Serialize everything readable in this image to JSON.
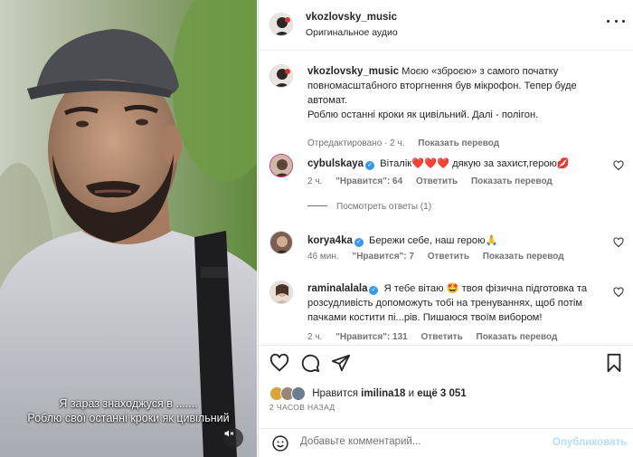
{
  "video": {
    "subtitle_line1": "Я зараз знаходжуся в .......",
    "subtitle_line2": "Роблю свої останні кроки як цивільний",
    "mute_icon": "speaker-muted-icon"
  },
  "header": {
    "username": "vkozlovsky_music",
    "audio_label": "Оригинальное аудио",
    "more_icon": "more-horizontal-icon"
  },
  "caption": {
    "username": "vkozlovsky_music",
    "text_lines": [
      "Моєю «зброєю» з самого початку",
      "повномасштабного вторгнення був мікрофон. Тепер буде",
      "автомат.",
      "Роблю останні кроки як цивільний. Далі - полігон."
    ],
    "edited": "Отредактировано · 2 ч.",
    "translate": "Показать перевод"
  },
  "comments": [
    {
      "username": "cybulskaya",
      "text": "Віталік❤️❤️❤️ дякую за захист,герою💋",
      "time": "2 ч.",
      "likes": "\"Нравится\": 64",
      "reply": "Ответить",
      "translate": "Показать перевод",
      "view_replies": "Посмотреть ответы (1)"
    },
    {
      "username": "korya4ka",
      "text": "Бережи себе, наш герою🙏",
      "time": "46 мин.",
      "likes": "\"Нравится\": 7",
      "reply": "Ответить",
      "translate": "Показать перевод"
    },
    {
      "username": "raminalalala",
      "text_line1": "Я тебе вітаю 🤩 твоя фізична підготовка та",
      "text_line2": "розсудливість допоможуть тобі на тренуваннях, щоб потім",
      "text_line3": "пачками костити пі...рів. Пишаюся твоїм вибором!",
      "time": "2 ч.",
      "likes": "\"Нравится\": 131",
      "reply": "Ответить",
      "translate": "Показать перевод"
    }
  ],
  "actions": {
    "like_icon": "heart-icon",
    "comment_icon": "comment-icon",
    "share_icon": "paper-plane-icon",
    "save_icon": "bookmark-icon"
  },
  "likes": {
    "prefix": "Нравится",
    "user": "imilina18",
    "joiner": "и",
    "rest": "ещё 3 051"
  },
  "timestamp": "2 ЧАСОВ НАЗАД",
  "composer": {
    "placeholder": "Добавьте комментарий...",
    "post_label": "Опубликовать",
    "emoji_icon": "emoji-smile-icon"
  },
  "colors": {
    "verified": "#3897f0",
    "post_disabled": "#b2dffc",
    "secondary_text": "#737373"
  }
}
